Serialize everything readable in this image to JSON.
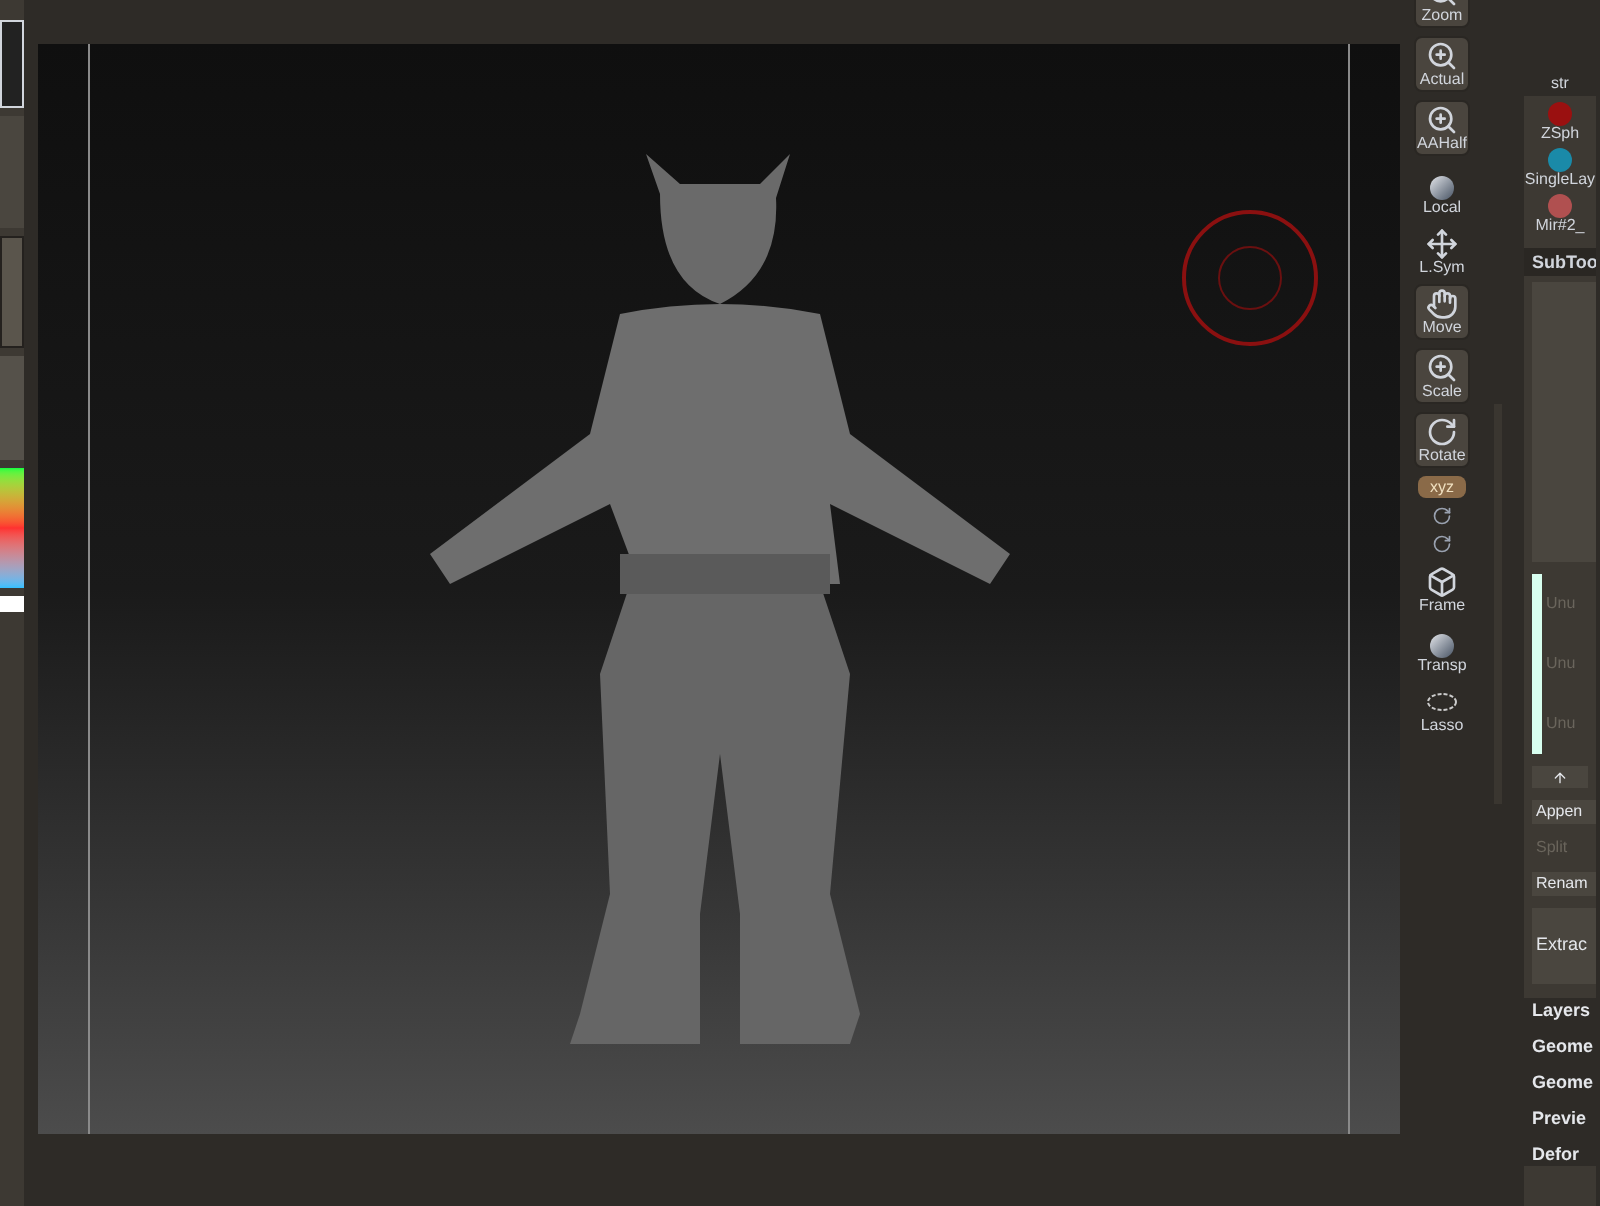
{
  "toolbar": [
    {
      "label": "Zoom",
      "kind": "boxed"
    },
    {
      "label": "Actual",
      "kind": "boxed"
    },
    {
      "label": "AAHalf",
      "kind": "boxed"
    },
    {
      "label": "Local",
      "kind": "plain"
    },
    {
      "label": "L.Sym",
      "kind": "plain"
    },
    {
      "label": "Move",
      "kind": "boxed"
    },
    {
      "label": "Scale",
      "kind": "boxed"
    },
    {
      "label": "Rotate",
      "kind": "boxed"
    },
    {
      "label": "xyz",
      "kind": "toggle",
      "on": true
    },
    {
      "kind": "rotate-small"
    },
    {
      "kind": "rotate-small"
    },
    {
      "label": "Frame",
      "kind": "plain"
    },
    {
      "label": "Transp",
      "kind": "plain"
    },
    {
      "label": "Lasso",
      "kind": "plain"
    }
  ],
  "tool_panel": {
    "thumb_label": "str",
    "items": [
      {
        "label": "ZSph",
        "color": "#9a1010"
      },
      {
        "label": "SingleLay",
        "color": "#1a8aa8"
      },
      {
        "label": "Mir#2_",
        "color": "#b05050"
      }
    ]
  },
  "subtool": {
    "title": "SubToo",
    "slots": [
      "Unu",
      "Unu",
      "Unu"
    ],
    "buttons": [
      {
        "label": "Appen",
        "disabled": false
      },
      {
        "label": "Split",
        "disabled": true
      },
      {
        "label": "Renam",
        "disabled": false
      }
    ],
    "extract": "Extrac"
  },
  "menu": [
    "Layers",
    "Geome",
    "Geome",
    "Previe",
    "Defor"
  ]
}
